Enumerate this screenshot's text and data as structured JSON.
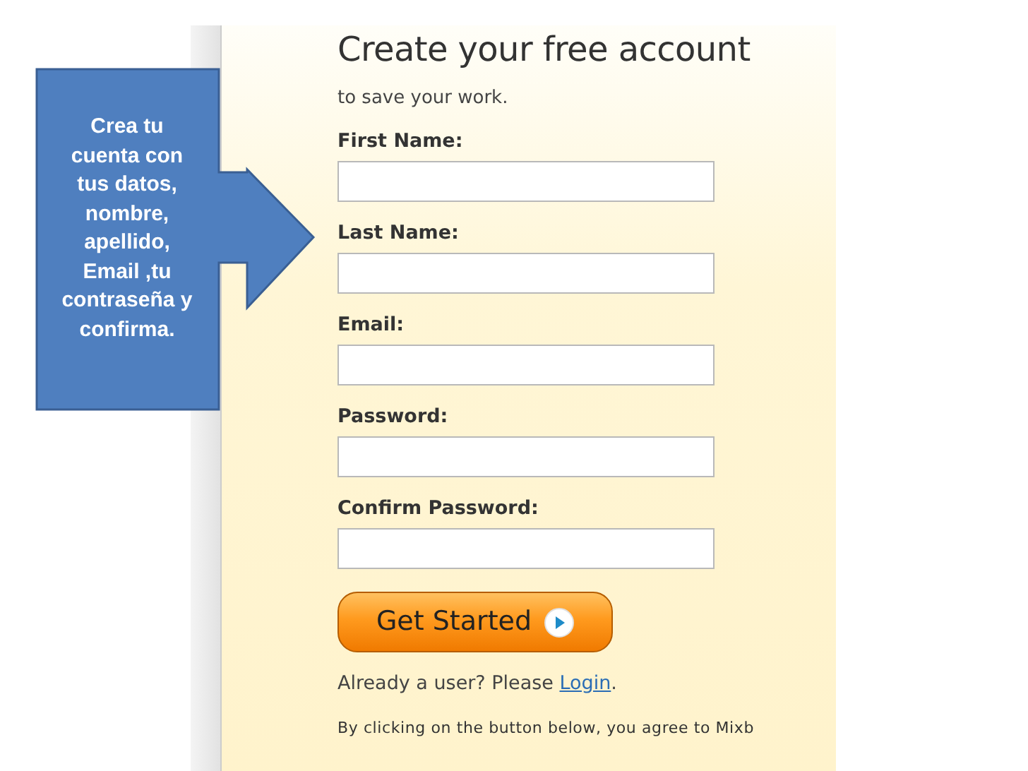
{
  "callout": {
    "text": "Crea tu cuenta con tus datos, nombre, apellido, Email ,tu contraseña y confirma."
  },
  "form": {
    "title": "Create your free account",
    "subtitle": "to save your work.",
    "fields": [
      {
        "label": "First Name:"
      },
      {
        "label": "Last Name:"
      },
      {
        "label": "Email:"
      },
      {
        "label": "Password:"
      },
      {
        "label": "Confirm Password:"
      }
    ],
    "submit_button": "Get Started",
    "login_prompt": {
      "before": "Already a user? Please ",
      "link": "Login",
      "after": "."
    },
    "terms": "By clicking on the button below, you agree to Mixb"
  }
}
